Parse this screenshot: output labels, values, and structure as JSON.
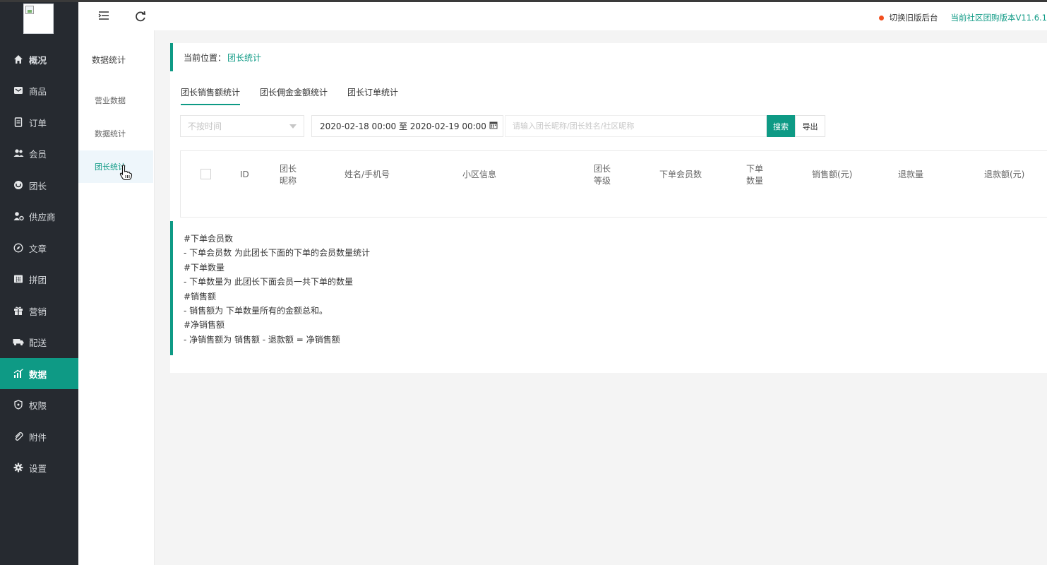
{
  "sidebar": {
    "items": [
      {
        "label": "概况",
        "icon": "home-icon",
        "glyph": "⌂"
      },
      {
        "label": "商品",
        "icon": "goods-icon",
        "glyph": "▣"
      },
      {
        "label": "订单",
        "icon": "order-icon",
        "glyph": "🗎"
      },
      {
        "label": "会员",
        "icon": "member-icon",
        "glyph": "👥"
      },
      {
        "label": "团长",
        "icon": "leader-icon",
        "glyph": "◉"
      },
      {
        "label": "供应商",
        "icon": "supplier-icon",
        "glyph": "♣"
      },
      {
        "label": "文章",
        "icon": "article-icon",
        "glyph": "◎"
      },
      {
        "label": "拼团",
        "icon": "group-buy-icon",
        "glyph": "▦"
      },
      {
        "label": "营销",
        "icon": "gift-icon",
        "glyph": "▥"
      },
      {
        "label": "配送",
        "icon": "truck-icon",
        "glyph": "⛟"
      },
      {
        "label": "数据",
        "icon": "chart-icon",
        "glyph": "◢"
      },
      {
        "label": "权限",
        "icon": "lock-icon",
        "glyph": "⊜"
      },
      {
        "label": "附件",
        "icon": "paperclip-icon",
        "glyph": "⊘"
      },
      {
        "label": "设置",
        "icon": "gear-icon",
        "glyph": "✱"
      }
    ],
    "active": "数据"
  },
  "subnav": {
    "title": "数据统计",
    "items": [
      "营业数据",
      "数据统计",
      "团长统计"
    ],
    "active": "团长统计"
  },
  "topbar": {
    "menu_icon": "menu-icon",
    "refresh_icon": "refresh-icon",
    "old_backend_link": "切换旧版后台",
    "version_text": "当前社区团购版本V11.6.1"
  },
  "breadcrumb": {
    "prefix": "当前位置：",
    "current": "团长统计"
  },
  "tabs": [
    "团长销售额统计",
    "团长佣金金额统计",
    "团长订单统计"
  ],
  "active_tab": "团长销售额统计",
  "filters": {
    "time_select": "不按时间",
    "date_range": "2020-02-18 00:00 至 2020-02-19 00:00",
    "search_placeholder": "请输入团长昵称/团长姓名/社区昵称",
    "search_button": "搜索",
    "export_button": "导出"
  },
  "table": {
    "headers": {
      "id": "ID",
      "nick_1": "团长",
      "nick_2": "昵称",
      "name_phone": "姓名/手机号",
      "community": "小区信息",
      "level_1": "团长",
      "level_2": "等级",
      "members": "下单会员数",
      "qty_1": "下单",
      "qty_2": "数量",
      "sales": "销售额(元)",
      "refund_qty": "退款量",
      "refund_amount": "退款额(元)"
    },
    "rows": []
  },
  "notes": [
    "#下单会员数",
    "- 下单会员数 为此团长下面的下单的会员数量统计",
    "#下单数量",
    "- 下单数量为 此团长下面会员一共下单的数量",
    "#销售额",
    "- 销售额为 下单数量所有的金额总和。",
    "#净销售额",
    "- 净销售额为 销售额 - 退款额 = 净销售额"
  ],
  "colors": {
    "accent": "#0e9a85",
    "sidebar_bg": "#262a30",
    "status_dot": "#f24e1e"
  }
}
